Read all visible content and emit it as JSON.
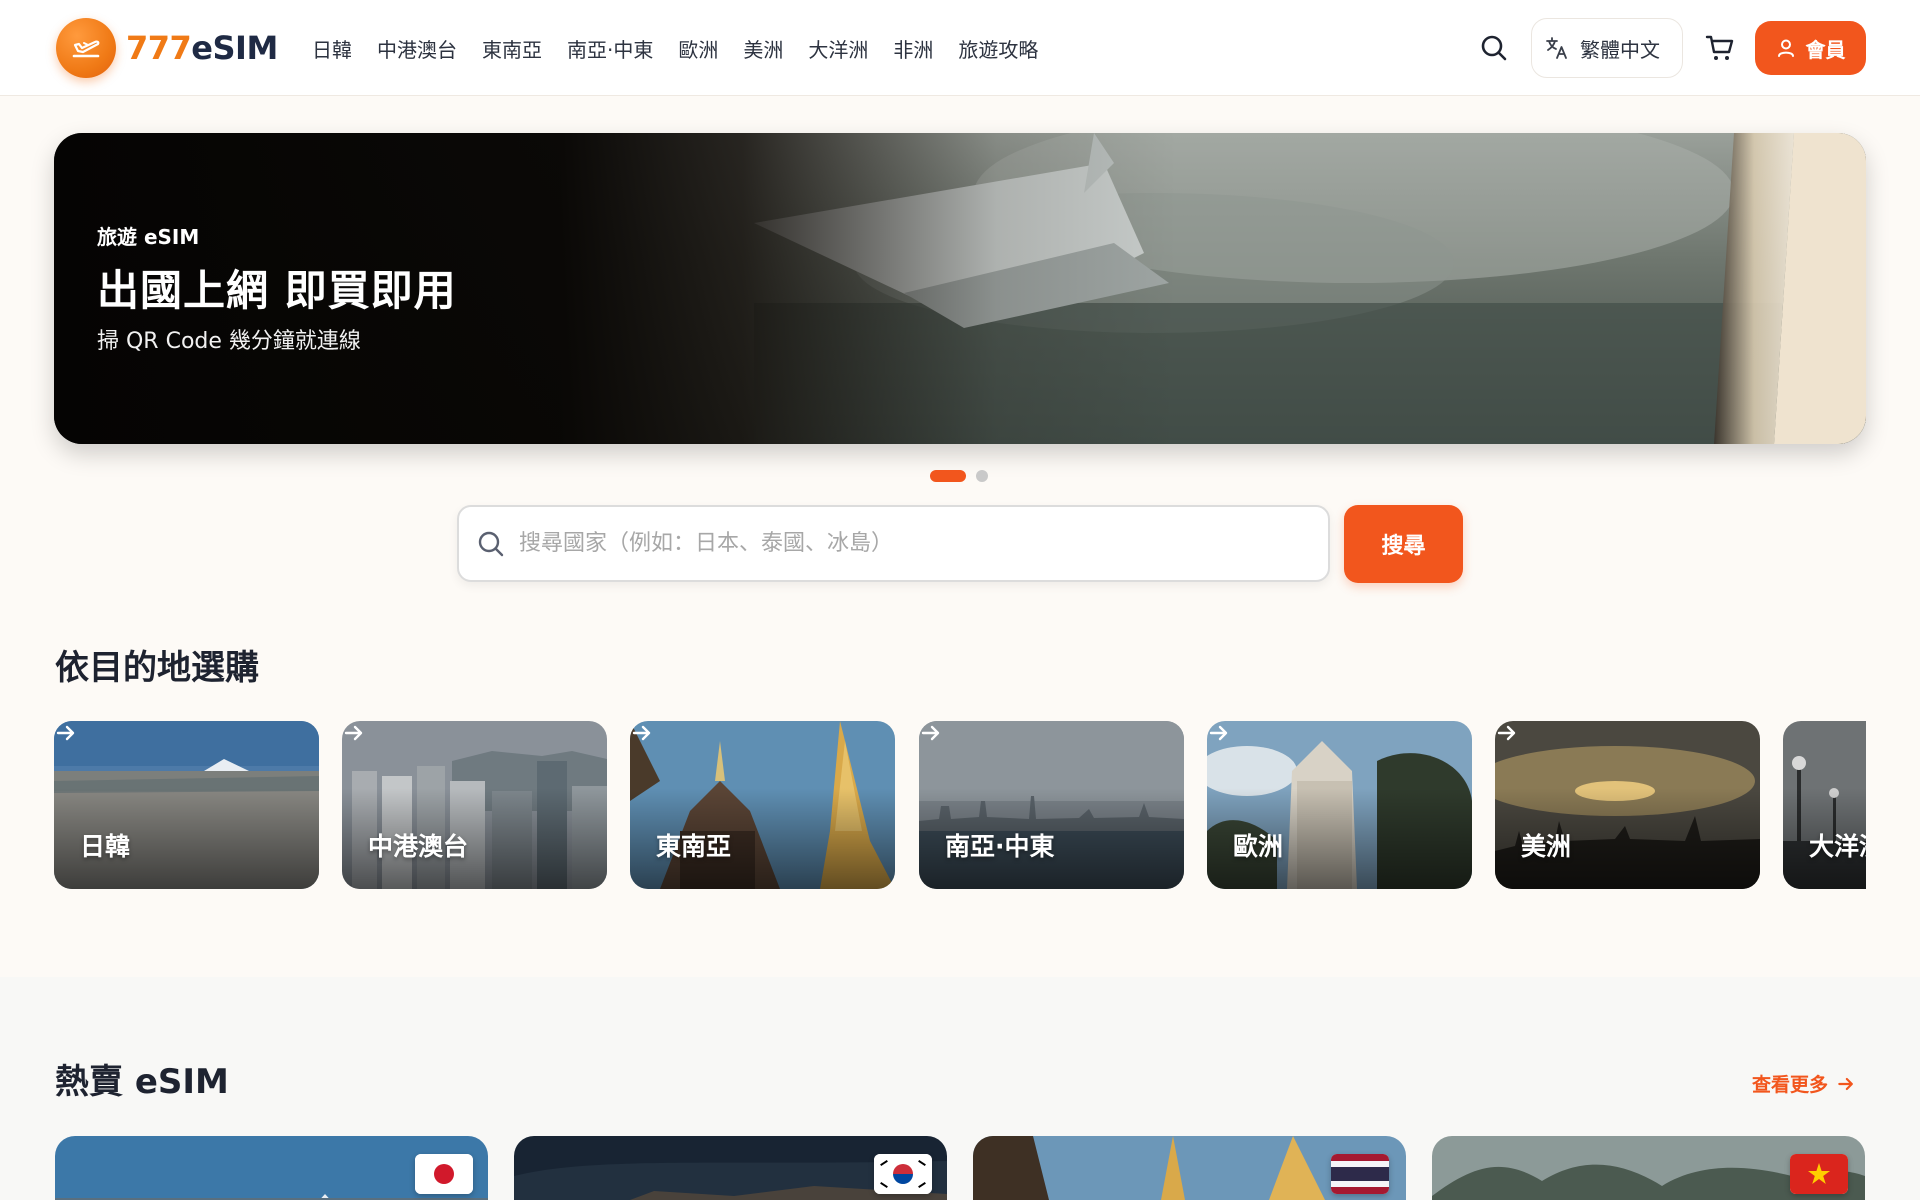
{
  "header": {
    "logo_number": "777",
    "logo_word": "eSIM",
    "nav": [
      "日韓",
      "中港澳台",
      "東南亞",
      "南亞·中東",
      "歐洲",
      "美洲",
      "大洋洲",
      "非洲",
      "旅遊攻略"
    ],
    "language": "繁體中文",
    "member": "會員"
  },
  "hero": {
    "kicker": "旅遊 eSIM",
    "title": "出國上網 即買即用",
    "subtitle": "掃 QR Code 幾分鐘就連線",
    "slide_count": 2,
    "active_slide": 1
  },
  "search": {
    "placeholder": "搜尋國家（例如：日本、泰國、冰島）",
    "button": "搜尋"
  },
  "destinations": {
    "title": "依目的地選購",
    "items": [
      "日韓",
      "中港澳台",
      "東南亞",
      "南亞·中東",
      "歐洲",
      "美洲",
      "大洋洲"
    ]
  },
  "hot": {
    "title": "熱賣 eSIM",
    "more": "查看更多"
  },
  "colors": {
    "accent": "#f2561d",
    "logo_orange": "#f07a16",
    "dark_text": "#1e2330"
  }
}
